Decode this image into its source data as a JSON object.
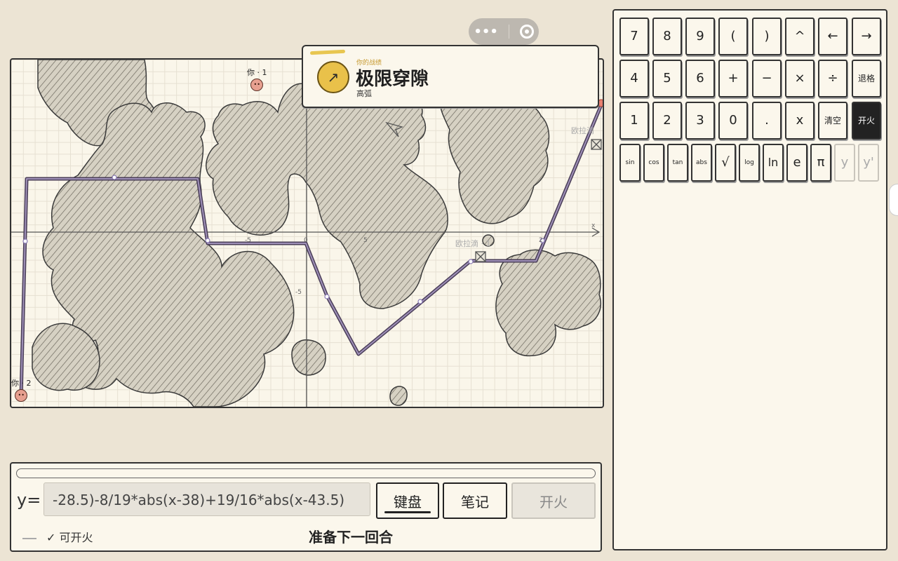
{
  "capsule": {
    "menu_icon": "more-dots-icon",
    "close_icon": "target-icon"
  },
  "achievement": {
    "caption": "你的战绩",
    "title": "极限穿隙",
    "subtitle": "高弧",
    "icon": "arrow-up-right-icon",
    "icon_glyph": "↗"
  },
  "board": {
    "axis_x": "x",
    "ticks": [
      {
        "label": "-5"
      },
      {
        "label": "0"
      },
      {
        "label": "5"
      },
      {
        "label": "2"
      },
      {
        "label": "-5"
      }
    ],
    "players": [
      {
        "label": "你 · 1"
      },
      {
        "label": "你 · 2"
      }
    ],
    "opponents": [
      {
        "label": "欧拉滴"
      },
      {
        "label": "欧拉滴 · 1"
      }
    ]
  },
  "bottom": {
    "y_label": "y=",
    "formula": "-28.5)-8/19*abs(x-38)+19/16*abs(x-43.5)",
    "keyboard_label": "键盘",
    "notes_label": "笔记",
    "fire_label": "开火",
    "status_label": "✓ 可开火",
    "round_label": "准备下一回合"
  },
  "keypad": {
    "row1": [
      "7",
      "8",
      "9",
      "(",
      ")",
      "^",
      "←",
      "→"
    ],
    "row2": [
      "4",
      "5",
      "6",
      "+",
      "−",
      "×",
      "÷",
      "退格"
    ],
    "row3": [
      "1",
      "2",
      "3",
      "0",
      ".",
      "x",
      "清空",
      "开火"
    ],
    "row4": [
      "sin",
      "cos",
      "tan",
      "abs",
      "√",
      "log",
      "ln",
      "e",
      "π",
      "y",
      "y'"
    ]
  }
}
